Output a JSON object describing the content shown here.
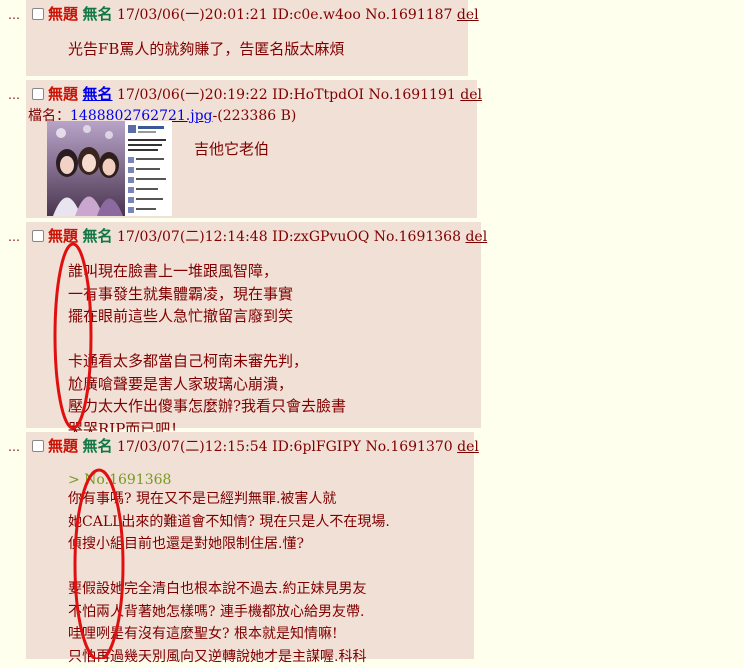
{
  "posts": [
    {
      "title": "無題",
      "name": "無名",
      "datetime": "17/03/06(一)20:01:21",
      "id": "ID:c0e.w4oo",
      "no": "No.1691187",
      "del": "del",
      "body": "光告FB罵人的就夠賺了，告匿名版太麻煩"
    },
    {
      "title": "無題",
      "name": "無名",
      "datetime": "17/03/06(一)20:19:22",
      "id": "ID:HoTtpdOI",
      "no": "No.1691191",
      "del": "del",
      "file_label": "檔名：",
      "file_name": "1488802762721.jpg",
      "file_size": "-(223386 B)",
      "body": "吉他它老伯"
    },
    {
      "title": "無題",
      "name": "無名",
      "datetime": "17/03/07(二)12:14:48",
      "id": "ID:zxGPvuOQ",
      "no": "No.1691368",
      "del": "del",
      "body": "誰叫現在臉書上一堆跟風智障，\n一有事發生就集體霸凌，現在事實\n擺在眼前這些人急忙撤留言廢到笑\n\n卡通看太多都當自己柯南未審先判，\n尬廣嗆聲要是害人家玻璃心崩潰，\n壓力太大作出傻事怎麼辦?我看只會去臉書\n哭哭RIP而已吧！"
    },
    {
      "title": "無題",
      "name": "無名",
      "datetime": "17/03/07(二)12:15:54",
      "id": "ID:6plFGIPY",
      "no": "No.1691370",
      "del": "del",
      "quote": "> No.1691368",
      "body": "你有事嗎? 現在又不是已經判無罪.被害人就\n她CALL出來的難道會不知情? 現在只是人不在現場.\n偵搜小組目前也還是對她限制住居.懂?\n\n要假設她完全清白也根本說不過去.約正妹見男友\n不怕兩人背著她怎樣嗎? 連手機都放心給男友帶.\n哇哩咧是有沒有這麼聖女? 根本就是知情嘛!\n只怕再過幾天別風向又逆轉說她才是主謀喔.科科"
    }
  ],
  "colors": {
    "page_bg": "#ffffee",
    "post_bg": "#f0e0d6",
    "title": "#cc1105",
    "name": "#117743",
    "text": "#800000",
    "oval": "#e01010"
  },
  "icons": {
    "thumbnail": "photo-thumbnail-icon",
    "checkbox": "checkbox-icon"
  }
}
